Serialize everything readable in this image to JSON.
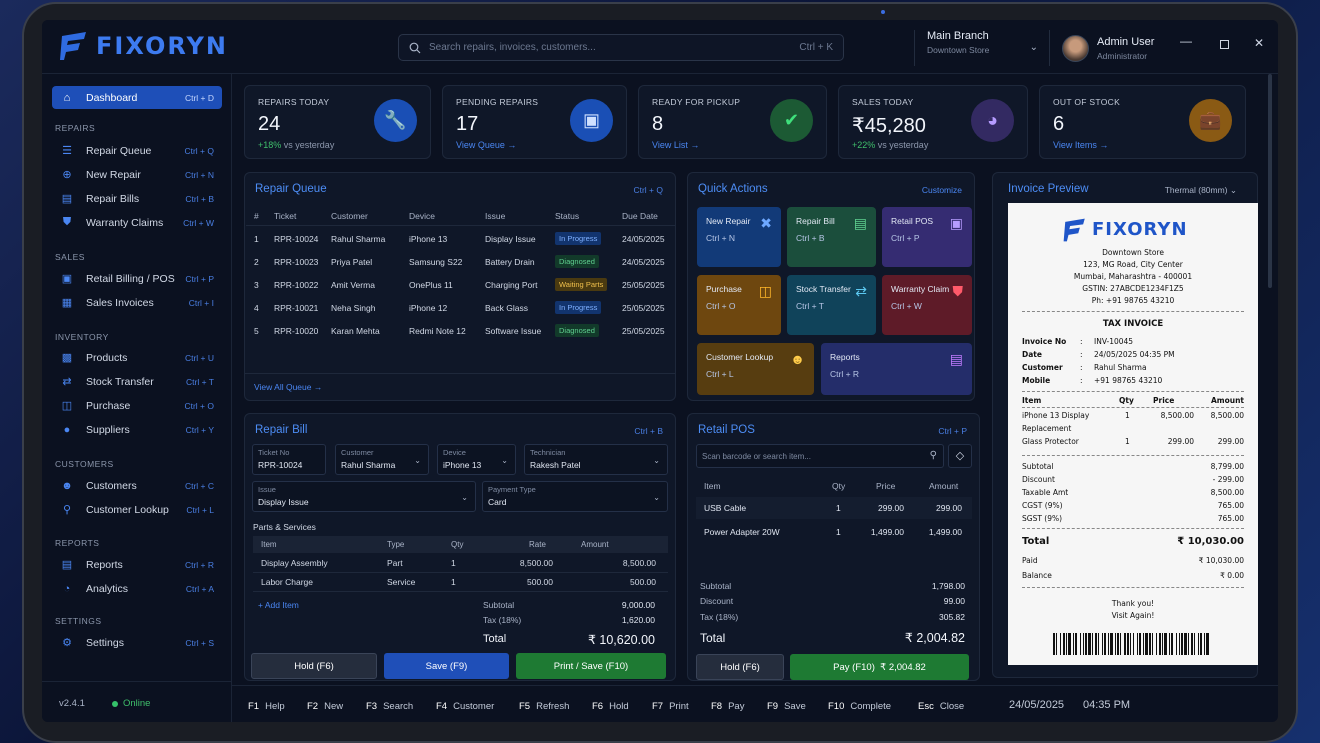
{
  "app": {
    "name": "FIXORYN",
    "version": "v2.4.1",
    "status": "Online"
  },
  "search": {
    "placeholder": "Search repairs, invoices, customers...",
    "shortcut": "Ctrl + K"
  },
  "branch": {
    "name": "Main Branch",
    "sub": "Downtown Store"
  },
  "user": {
    "name": "Admin User",
    "role": "Administrator"
  },
  "sidebar": {
    "dashboard": {
      "label": "Dashboard",
      "key": "Ctrl + D"
    },
    "sections": {
      "repairs": "REPAIRS",
      "sales": "SALES",
      "inventory": "INVENTORY",
      "customers": "CUSTOMERS",
      "reports": "REPORTS",
      "settings": "SETTINGS"
    },
    "items": [
      {
        "label": "Repair Queue",
        "key": "Ctrl + Q",
        "icon": "list-icon"
      },
      {
        "label": "New Repair",
        "key": "Ctrl + N",
        "icon": "plus-circle-icon"
      },
      {
        "label": "Repair Bills",
        "key": "Ctrl + B",
        "icon": "document-icon"
      },
      {
        "label": "Warranty Claims",
        "key": "Ctrl + W",
        "icon": "shield-icon"
      },
      {
        "label": "Retail Billing / POS",
        "key": "Ctrl + P",
        "icon": "cart-icon"
      },
      {
        "label": "Sales Invoices",
        "key": "Ctrl + I",
        "icon": "invoice-icon"
      },
      {
        "label": "Products",
        "key": "Ctrl + U",
        "icon": "box-icon"
      },
      {
        "label": "Stock Transfer",
        "key": "Ctrl + T",
        "icon": "transfer-icon"
      },
      {
        "label": "Purchase",
        "key": "Ctrl + O",
        "icon": "bag-icon"
      },
      {
        "label": "Suppliers",
        "key": "Ctrl + Y",
        "icon": "users-icon"
      },
      {
        "label": "Customers",
        "key": "Ctrl + C",
        "icon": "customers-icon"
      },
      {
        "label": "Customer Lookup",
        "key": "Ctrl + L",
        "icon": "search-icon"
      },
      {
        "label": "Reports",
        "key": "Ctrl + R",
        "icon": "report-icon"
      },
      {
        "label": "Analytics",
        "key": "Ctrl + A",
        "icon": "analytics-icon"
      },
      {
        "label": "Settings",
        "key": "Ctrl + S",
        "icon": "gear-icon"
      }
    ]
  },
  "stats": [
    {
      "label": "REPAIRS TODAY",
      "value": "24",
      "delta": "+18%",
      "sub": "vs yesterday",
      "color": "#1a4fb5"
    },
    {
      "label": "PENDING REPAIRS",
      "value": "17",
      "link": "View Queue",
      "color": "#1a4fb5"
    },
    {
      "label": "READY FOR PICKUP",
      "value": "8",
      "link": "View List",
      "color": "#1c6b3a"
    },
    {
      "label": "SALES TODAY",
      "value": "₹45,280",
      "delta": "+22%",
      "sub": "vs yesterday",
      "color": "#3a2f6e"
    },
    {
      "label": "OUT OF STOCK",
      "value": "6",
      "link": "View Items",
      "color": "#8a5a14"
    }
  ],
  "repair_queue": {
    "title": "Repair Queue",
    "key": "Ctrl + Q",
    "view_all": "View All Queue",
    "headers": [
      "#",
      "Ticket",
      "Customer",
      "Device",
      "Issue",
      "Status",
      "Due Date"
    ],
    "rows": [
      [
        "1",
        "RPR-10024",
        "Rahul Sharma",
        "iPhone 13",
        "Display Issue",
        "In Progress",
        "24/05/2025"
      ],
      [
        "2",
        "RPR-10023",
        "Priya Patel",
        "Samsung S22",
        "Battery Drain",
        "Diagnosed",
        "24/05/2025"
      ],
      [
        "3",
        "RPR-10022",
        "Amit Verma",
        "OnePlus 11",
        "Charging Port",
        "Waiting Parts",
        "25/05/2025"
      ],
      [
        "4",
        "RPR-10021",
        "Neha Singh",
        "iPhone 12",
        "Back Glass",
        "In Progress",
        "25/05/2025"
      ],
      [
        "5",
        "RPR-10020",
        "Karan Mehta",
        "Redmi Note 12",
        "Software Issue",
        "Diagnosed",
        "25/05/2025"
      ]
    ]
  },
  "quick_actions": {
    "title": "Quick Actions",
    "customize": "Customize",
    "items": [
      {
        "label": "New Repair",
        "key": "Ctrl + N",
        "bg": "#123a78"
      },
      {
        "label": "Repair Bill",
        "key": "Ctrl + B",
        "bg": "#1c5a40"
      },
      {
        "label": "Retail POS",
        "key": "Ctrl + P",
        "bg": "#3a2f7a"
      },
      {
        "label": "Purchase",
        "key": "Ctrl + O",
        "bg": "#7a4e10"
      },
      {
        "label": "Stock Transfer",
        "key": "Ctrl + T",
        "bg": "#124a5e"
      },
      {
        "label": "Warranty Claim",
        "key": "Ctrl + W",
        "bg": "#6a1e2a"
      },
      {
        "label": "Customer Lookup",
        "key": "Ctrl + L",
        "bg": "#5e4210"
      },
      {
        "label": "Reports",
        "key": "Ctrl + R",
        "bg": "#26306e"
      }
    ]
  },
  "invoice_preview": {
    "title": "Invoice Preview",
    "printer": "Thermal (80mm)",
    "store": "Downtown Store",
    "address1": "123, MG Road, City Center",
    "address2": "Mumbai, Maharashtra - 400001",
    "gstin": "GSTIN: 27ABCDE1234F1Z5",
    "phone": "Ph: +91 98765 43210",
    "doc_title": "TAX INVOICE",
    "meta": [
      [
        "Invoice No",
        ":",
        "INV-10045"
      ],
      [
        "Date",
        ":",
        "24/05/2025 04:35 PM"
      ],
      [
        "Customer",
        ":",
        "Rahul Sharma"
      ],
      [
        "Mobile",
        ":",
        "+91 98765 43210"
      ]
    ],
    "headers": [
      "Item",
      "Qty",
      "Price",
      "Amount"
    ],
    "items": [
      [
        "iPhone 13 Display",
        "1",
        "8,500.00",
        "8,500.00"
      ],
      [
        "Replacement",
        "",
        "",
        ""
      ],
      [
        "Glass Protector",
        "1",
        "299.00",
        "299.00"
      ]
    ],
    "totals": [
      [
        "Subtotal",
        "8,799.00"
      ],
      [
        "Discount",
        "- 299.00"
      ],
      [
        "Taxable Amt",
        "8,500.00"
      ],
      [
        "CGST (9%)",
        "765.00"
      ],
      [
        "SGST (9%)",
        "765.00"
      ]
    ],
    "total_label": "Total",
    "total": "₹ 10,030.00",
    "paid": [
      "Paid",
      "₹ 10,030.00"
    ],
    "balance": [
      "Balance",
      "₹ 0.00"
    ],
    "thanks1": "Thank you!",
    "thanks2": "Visit Again!"
  },
  "repair_bill": {
    "title": "Repair Bill",
    "key": "Ctrl + B",
    "ticket": {
      "label": "Ticket No",
      "value": "RPR-10024"
    },
    "customer": {
      "label": "Customer",
      "value": "Rahul Sharma"
    },
    "device": {
      "label": "Device",
      "value": "iPhone 13"
    },
    "technician": {
      "label": "Technician",
      "value": "Rakesh Patel"
    },
    "issue": {
      "label": "Issue",
      "value": "Display Issue"
    },
    "payment": {
      "label": "Payment Type",
      "value": "Card"
    },
    "parts_title": "Parts & Services",
    "headers": [
      "Item",
      "Type",
      "Qty",
      "Rate",
      "Amount"
    ],
    "rows": [
      [
        "Display Assembly",
        "Part",
        "1",
        "8,500.00",
        "8,500.00"
      ],
      [
        "Labor Charge",
        "Service",
        "1",
        "500.00",
        "500.00"
      ]
    ],
    "add_item": "+ Add Item",
    "subtotal": [
      "Subtotal",
      "9,000.00"
    ],
    "tax": [
      "Tax (18%)",
      "1,620.00"
    ],
    "total": [
      "Total",
      "₹ 10,620.00"
    ],
    "hold": "Hold (F6)",
    "save": "Save (F9)",
    "print": "Print / Save (F10)"
  },
  "retail_pos": {
    "title": "Retail POS",
    "key": "Ctrl + P",
    "placeholder": "Scan barcode or search item...",
    "headers": [
      "Item",
      "Qty",
      "Price",
      "Amount"
    ],
    "rows": [
      [
        "USB Cable",
        "1",
        "299.00",
        "299.00"
      ],
      [
        "Power Adapter 20W",
        "1",
        "1,499.00",
        "1,499.00"
      ]
    ],
    "subtotal": [
      "Subtotal",
      "1,798.00"
    ],
    "discount": [
      "Discount",
      "99.00"
    ],
    "tax": [
      "Tax (18%)",
      "305.82"
    ],
    "total": [
      "Total",
      "₹ 2,004.82"
    ],
    "hold": "Hold (F6)",
    "pay": "Pay (F10)",
    "pay_amount": "₹ 2,004.82"
  },
  "footer": {
    "keys": [
      [
        "F1",
        "Help"
      ],
      [
        "F2",
        "New"
      ],
      [
        "F3",
        "Search"
      ],
      [
        "F4",
        "Customer"
      ],
      [
        "F5",
        "Refresh"
      ],
      [
        "F6",
        "Hold"
      ],
      [
        "F7",
        "Print"
      ],
      [
        "F8",
        "Pay"
      ],
      [
        "F9",
        "Save"
      ],
      [
        "F10",
        "Complete"
      ],
      [
        "Esc",
        "Close"
      ]
    ],
    "date": "24/05/2025",
    "time": "04:35 PM"
  }
}
